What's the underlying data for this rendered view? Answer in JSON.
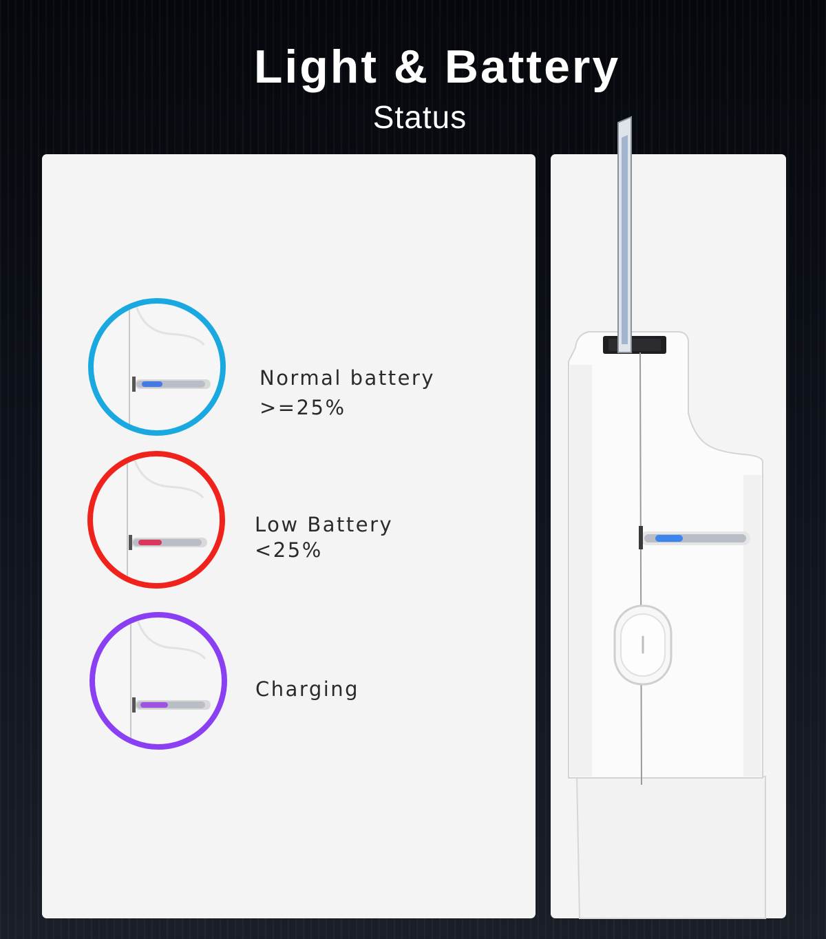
{
  "header": {
    "title": "Light & Battery",
    "subtitle": "Status"
  },
  "status_items": [
    {
      "label": "Normal battery",
      "sublabel": ">=25%",
      "ring_color": "#19a9e0",
      "light_color": "#2f6fe8"
    },
    {
      "label": "Low Battery",
      "sublabel": "<25%",
      "ring_color": "#f0231c",
      "light_color": "#e0204a"
    },
    {
      "label": "Charging",
      "sublabel": "",
      "ring_color": "#8a3ff2",
      "light_color": "#9b3fe6"
    }
  ],
  "device": {
    "indicator_color": "#2f7ef0"
  }
}
